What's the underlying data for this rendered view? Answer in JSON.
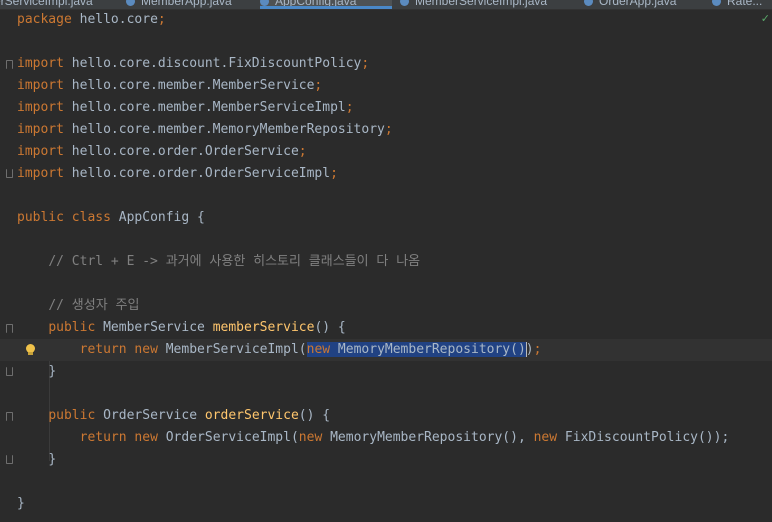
{
  "tabs": [
    {
      "label": "erServiceImpl.java"
    },
    {
      "label": "MemberApp.java"
    },
    {
      "label": "AppConfig.java",
      "active": true
    },
    {
      "label": "MemberServiceImpl.java"
    },
    {
      "label": "OrderApp.java"
    },
    {
      "label": "Rate..."
    }
  ],
  "code": {
    "package_kw": "package",
    "package_name": " hello.core",
    "import_kw": "import",
    "imports": [
      " hello.core.discount.FixDiscountPolicy",
      " hello.core.member.MemberService",
      " hello.core.member.MemberServiceImpl",
      " hello.core.member.MemoryMemberRepository",
      " hello.core.order.OrderService",
      " hello.core.order.OrderServiceImpl"
    ],
    "semicolon": ";",
    "public_kw": "public",
    "class_kw": "class",
    "new_kw": "new",
    "return_kw": "return",
    "class_name": " AppConfig {",
    "comment1": "// Ctrl + E -> 과거에 사용한 히스토리 클래스들이 다 나옴",
    "comment2": "// 생성자 주입",
    "member_type": " MemberService ",
    "member_method": "memberService",
    "method_tail": "() {",
    "member_impl": " MemberServiceImpl(",
    "member_arg": " MemoryMemberRepository()",
    "member_close_paren": ")",
    "member_end": ");",
    "order_type": " OrderService ",
    "order_method": "orderService",
    "order_impl": " OrderServiceImpl(",
    "order_arg1": " MemoryMemberRepository(), ",
    "order_arg2": " FixDiscountPolicy());",
    "brace_close": "}"
  },
  "colors": {
    "background": "#2b2b2b",
    "keyword": "#cc7832",
    "method": "#ffc66d",
    "comment": "#808080",
    "text": "#a9b7c6",
    "selection": "#214283"
  }
}
